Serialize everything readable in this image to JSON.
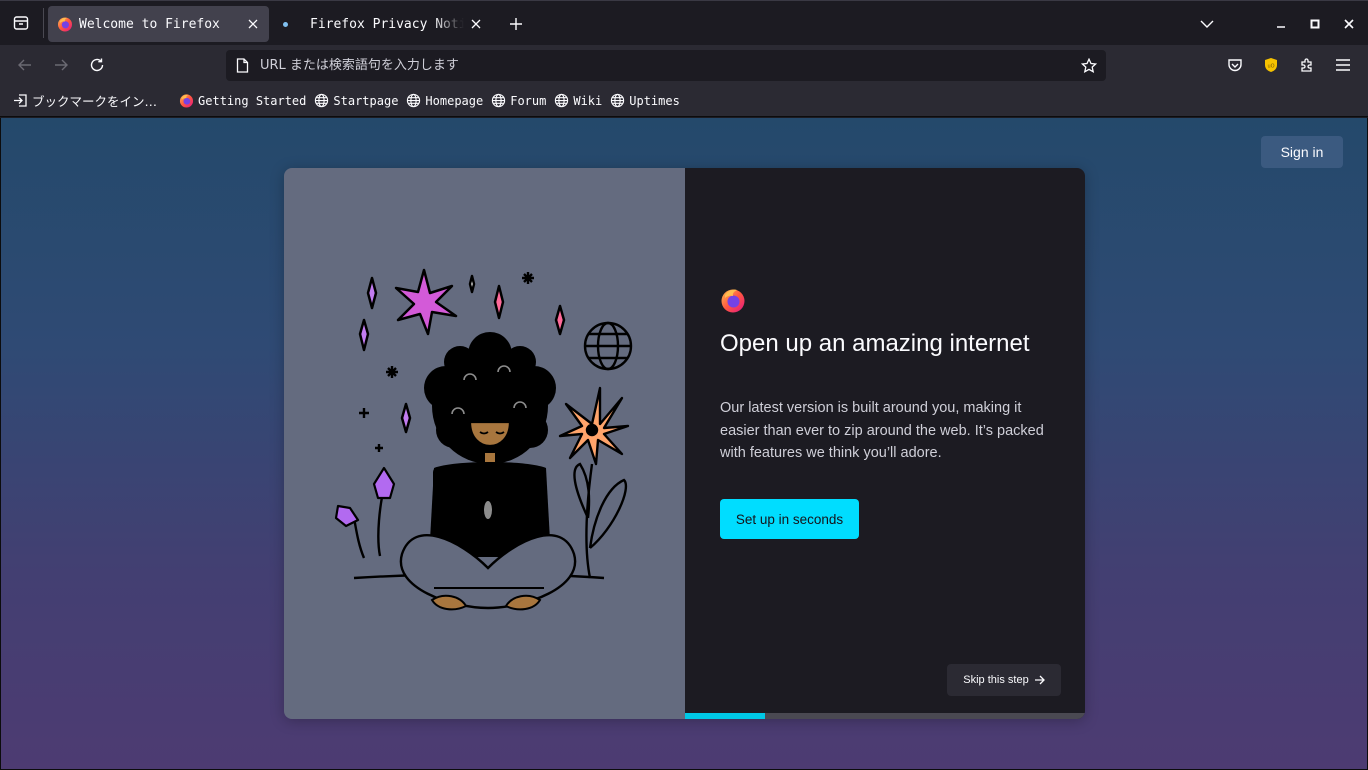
{
  "tabs": [
    {
      "title": "Welcome to Firefox",
      "active": true
    },
    {
      "title": "Firefox Privacy Notice — Mozilla",
      "active": false
    }
  ],
  "urlbar": {
    "placeholder": "URL または検索語句を入力します",
    "value": ""
  },
  "bookmarks": {
    "import_label": "ブックマークをイン…",
    "items": [
      {
        "label": "Getting Started",
        "icon": "firefox-icon"
      },
      {
        "label": "Startpage",
        "icon": "globe-icon"
      },
      {
        "label": "Homepage",
        "icon": "globe-icon"
      },
      {
        "label": "Forum",
        "icon": "globe-icon"
      },
      {
        "label": "Wiki",
        "icon": "globe-icon"
      },
      {
        "label": "Uptimes",
        "icon": "globe-icon"
      }
    ]
  },
  "content": {
    "sign_in": "Sign in",
    "headline": "Open up an amazing internet",
    "description": "Our latest version is built around you, making it easier than ever to zip around the web. It’s packed with features we think you’ll adore.",
    "primary_button": "Set up in seconds",
    "skip_button": "Skip this step",
    "progress_fraction": 0.2
  },
  "colors": {
    "accent": "#00ddff",
    "panel": "#1c1b22",
    "art_bg": "#646b7f"
  }
}
